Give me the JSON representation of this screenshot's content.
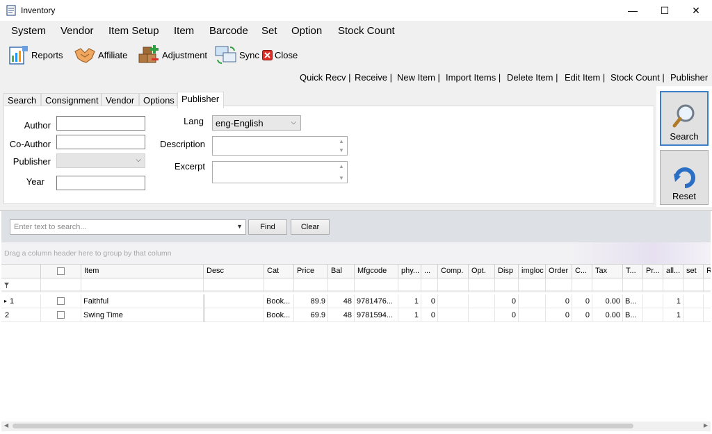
{
  "window": {
    "title": "Inventory",
    "controls": {
      "minimize": "—",
      "maximize": "☐",
      "close": "✕"
    }
  },
  "menu": [
    "System",
    "Vendor",
    "Item Setup",
    "Item",
    "Barcode",
    "Set",
    "Option",
    "Stock Count"
  ],
  "toolbar": {
    "reports": "Reports",
    "affiliate": "Affiliate",
    "adjustment": "Adjustment",
    "sync": "Sync",
    "close": "Close"
  },
  "links": [
    "Quick Recv |",
    "Receive |",
    "New Item |",
    "Import Items |",
    "Delete Item |",
    "Edit Item |",
    "Stock Count |",
    "Publisher"
  ],
  "tabs": [
    "Search",
    "Consignment",
    "Vendor",
    "Options",
    "Publisher"
  ],
  "active_tab": "Publisher",
  "form": {
    "author_label": "Author",
    "coauthor_label": "Co-Author",
    "publisher_label": "Publisher",
    "year_label": "Year",
    "lang_label": "Lang",
    "lang_value": "eng-English",
    "description_label": "Description",
    "excerpt_label": "Excerpt",
    "author_value": "",
    "coauthor_value": "",
    "publisher_value": "",
    "year_value": "",
    "description_value": "",
    "excerpt_value": ""
  },
  "side_buttons": {
    "search": "Search",
    "reset": "Reset"
  },
  "gridbar": {
    "search_placeholder": "Enter text to search...",
    "find": "Find",
    "clear": "Clear",
    "group_hint": "Drag a column header here to group by that column"
  },
  "columns": [
    "",
    "",
    "Item",
    "Desc",
    "Cat",
    "Price",
    "Bal",
    "Mfgcode",
    "phy...",
    "...",
    "Comp.",
    "Opt.",
    "Disp",
    "imgloc",
    "Order",
    "C...",
    "Tax",
    "T...",
    "Pr...",
    "all...",
    "set",
    "R"
  ],
  "rows": [
    {
      "indicator": "▸",
      "num": "1",
      "item": "Faithful",
      "desc": "",
      "cat": "Book...",
      "price": "89.9",
      "bal": "48",
      "mfgcode": "9781476...",
      "phy": "1",
      "c9": "0",
      "comp": "",
      "opt": "",
      "disp": "0",
      "imgloc": "",
      "order": "0",
      "c": "0",
      "tax": "0.00",
      "t": "B...",
      "pr": "",
      "all": "1",
      "set": "",
      "r": ""
    },
    {
      "indicator": "",
      "num": "2",
      "item": "Swing Time",
      "desc": "",
      "cat": "Book...",
      "price": "69.9",
      "bal": "48",
      "mfgcode": "9781594...",
      "phy": "1",
      "c9": "0",
      "comp": "",
      "opt": "",
      "disp": "0",
      "imgloc": "",
      "order": "0",
      "c": "0",
      "tax": "0.00",
      "t": "B...",
      "pr": "",
      "all": "1",
      "set": "",
      "r": ""
    }
  ],
  "icons": {
    "app": "document-icon",
    "reports": "report-chart-icon",
    "affiliate": "handshake-icon",
    "adjustment": "boxes-plus-icon",
    "sync": "sync-screens-icon",
    "close": "close-red-icon",
    "search": "magnifier-icon",
    "reset": "refresh-arrow-icon",
    "filter": "filter-icon"
  },
  "colors": {
    "accent": "#3d7ec8",
    "close_red": "#d9302a",
    "grid_header": "#f7f7f7"
  }
}
